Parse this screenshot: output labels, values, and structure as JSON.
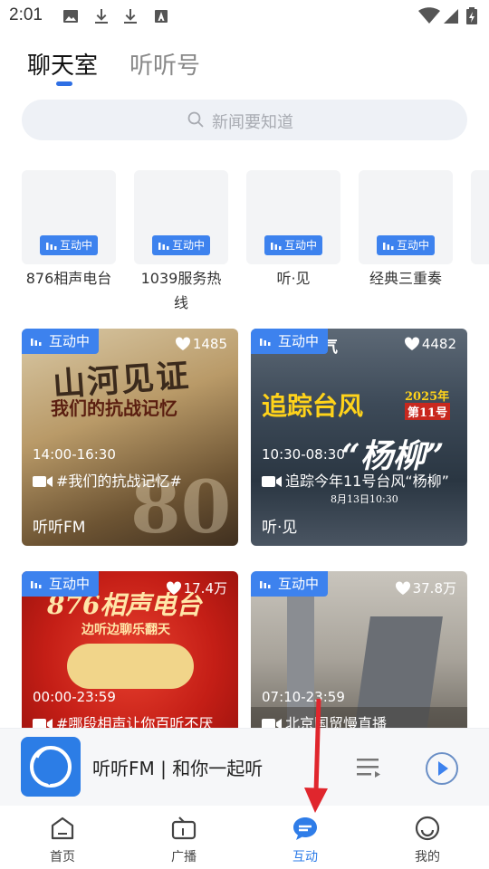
{
  "status_bar": {
    "time": "2:01"
  },
  "tabs": [
    {
      "label": "聊天室",
      "active": true
    },
    {
      "label": "听听号",
      "active": false
    }
  ],
  "search": {
    "placeholder": "新闻要知道"
  },
  "colors": {
    "accent": "#3d82ee",
    "indicator": "#2f6fe4",
    "nav_active": "#2f7de8"
  },
  "small_cards": [
    {
      "badge": "互动中",
      "label": "876相声电台"
    },
    {
      "badge": "互动中",
      "label": "1039服务热线"
    },
    {
      "badge": "互动中",
      "label": "听·见"
    },
    {
      "badge": "互动中",
      "label": "经典三重奏"
    }
  ],
  "big_cards": [
    {
      "badge": "互动中",
      "likes": "1485",
      "time": "14:00-16:30",
      "topic": "#我们的抗战记忆#",
      "station": "听听FM",
      "poster_title": "山河见证",
      "poster_subtitle": "我们的抗战记忆",
      "poster_number": "80"
    },
    {
      "badge": "互动中",
      "likes": "4482",
      "time": "10:30-08:30",
      "topic": "追踪今年11号台风“杨柳”",
      "station": "听·见",
      "poster_title": "追踪台风",
      "poster_subtitle": "“杨柳”",
      "poster_tag1": "2025年",
      "poster_tag2": "第11号",
      "poster_date": "8月13日10:30",
      "poster_top": "天气"
    },
    {
      "badge": "互动中",
      "likes": "17.4万",
      "time": "00:00-23:59",
      "topic": "#哪段相声让你百听不厌",
      "station": "",
      "poster_title": "876相声电台",
      "poster_subtitle": "边听边聊乐翻天"
    },
    {
      "badge": "互动中",
      "likes": "37.8万",
      "time": "07:10-23:59",
      "topic": "北京国贸慢直播",
      "station": ""
    }
  ],
  "player": {
    "title": "听听FM | 和你一起听"
  },
  "bottom_nav": [
    {
      "label": "首页",
      "icon": "home-icon",
      "active": false
    },
    {
      "label": "广播",
      "icon": "radio-icon",
      "active": false
    },
    {
      "label": "互动",
      "icon": "chat-bubble-icon",
      "active": true
    },
    {
      "label": "我的",
      "icon": "profile-icon",
      "active": false
    }
  ]
}
